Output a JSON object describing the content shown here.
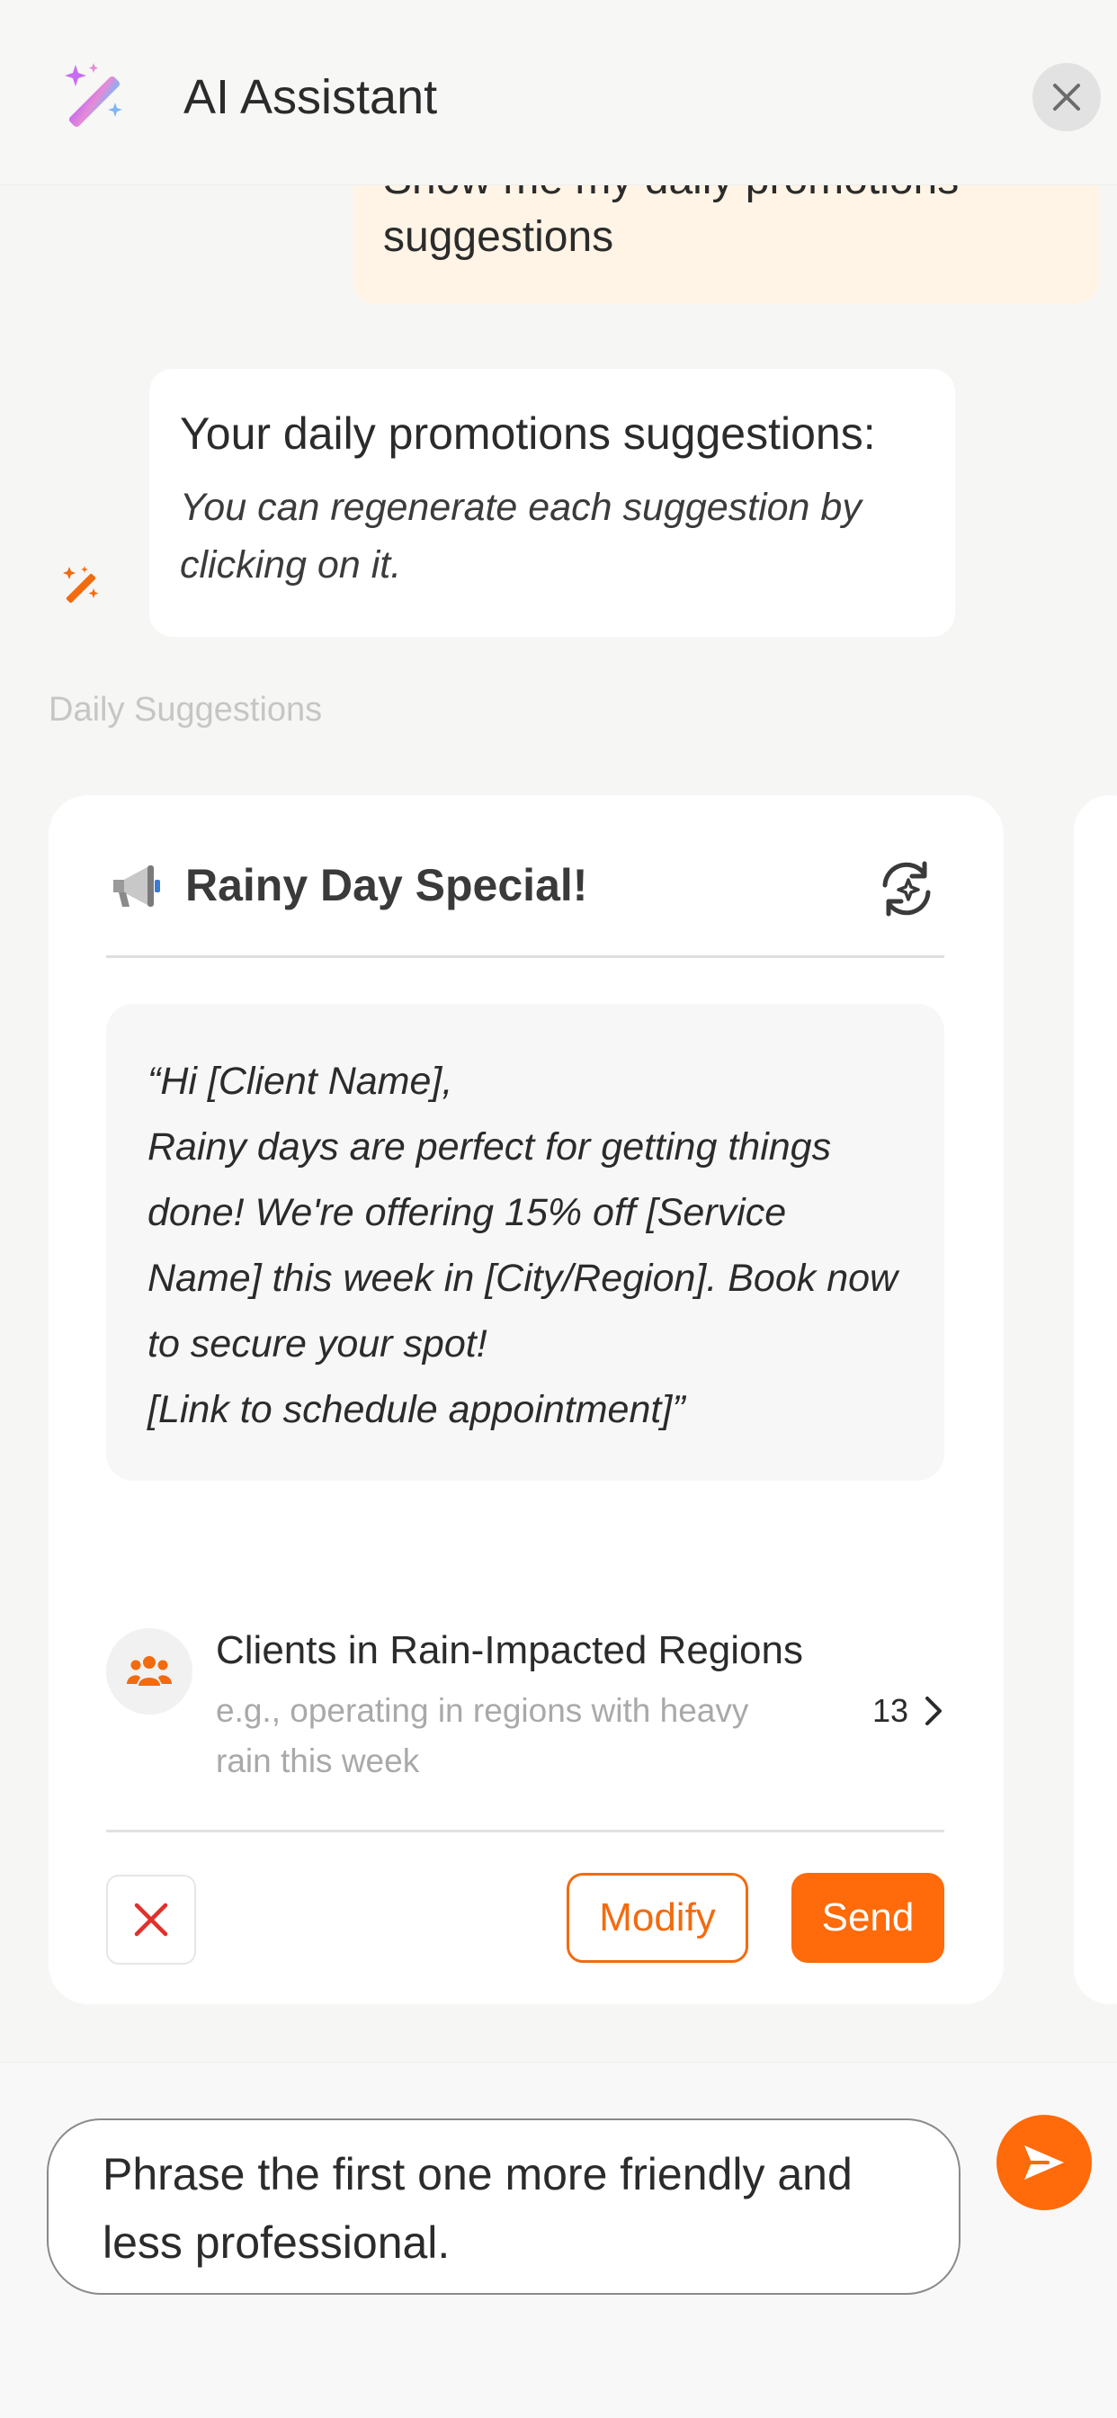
{
  "header": {
    "title": "AI Assistant",
    "icon": "magic-wand-icon",
    "close_icon": "close-icon"
  },
  "conversation": {
    "user_message": {
      "clipped_line": "Show me my daily promotions",
      "visible_line": "suggestions"
    },
    "assistant_message": {
      "heading": "Your daily promotions suggestions:",
      "subtext": "You can regenerate each suggestion by clicking on it."
    }
  },
  "section_label": "Daily Suggestions",
  "suggestion_card": {
    "icon": "megaphone-icon",
    "title": "Rainy Day Special!",
    "regenerate_icon": "regenerate-icon",
    "message_lines": [
      "“Hi [Client Name],",
      "Rainy days are perfect for getting things",
      "done! We're offering 15% off [Service",
      "Name] this week in [City/Region]. Book now",
      "to secure your spot!",
      "[Link to schedule appointment]”"
    ],
    "audience": {
      "icon": "users-icon",
      "title": "Clients in Rain-Impacted Regions",
      "description": "e.g., operating in regions with heavy rain this week",
      "count": "13"
    },
    "actions": {
      "dismiss_icon": "close-icon",
      "modify_label": "Modify",
      "send_label": "Send"
    }
  },
  "composer": {
    "value": "Phrase the first one more friendly and less professional.",
    "send_icon": "send-icon"
  },
  "colors": {
    "accent": "#ff6a0a",
    "user_bubble": "#fff4e6",
    "background": "#f6f6f5",
    "danger": "#e0302b"
  }
}
